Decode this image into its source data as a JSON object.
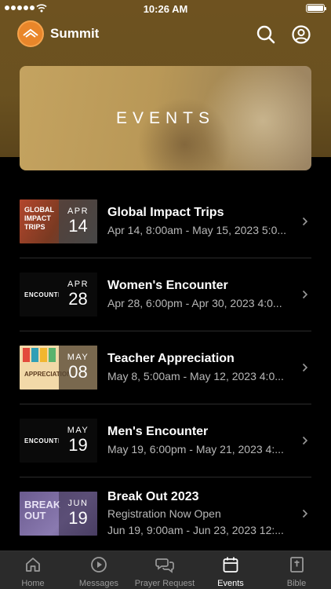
{
  "status_bar": {
    "time": "10:26 AM"
  },
  "header": {
    "app_title": "Summit",
    "accent_color": "#e9862a"
  },
  "banner": {
    "title": "EVENTS"
  },
  "events": [
    {
      "title": "Global Impact Trips",
      "lines": [
        "Apr 14, 8:00am - May 15, 2023 5:0..."
      ],
      "month": "APR",
      "day": "14",
      "thumb_text": "GLOBAL IMPACT TRIPS"
    },
    {
      "title": "Women's Encounter",
      "lines": [
        "Apr 28, 6:00pm - Apr 30, 2023 4:0..."
      ],
      "month": "APR",
      "day": "28",
      "thumb_text": "ENCOUNTER"
    },
    {
      "title": "Teacher Appreciation",
      "lines": [
        "May 8, 5:00am - May 12, 2023 4:0..."
      ],
      "month": "MAY",
      "day": "08",
      "thumb_text": "APPRECIATION"
    },
    {
      "title": "Men's Encounter",
      "lines": [
        "May 19, 6:00pm - May 21, 2023 4:..."
      ],
      "month": "MAY",
      "day": "19",
      "thumb_text": "ENCOUNTER"
    },
    {
      "title": "Break Out 2023",
      "lines": [
        "Registration Now Open",
        "Jun 19, 9:00am - Jun 23, 2023 12:..."
      ],
      "month": "JUN",
      "day": "19",
      "thumb_text": "BREAK OUT"
    }
  ],
  "tabs": [
    {
      "label": "Home",
      "icon": "home-icon",
      "active": false
    },
    {
      "label": "Messages",
      "icon": "play-icon",
      "active": false
    },
    {
      "label": "Prayer Request",
      "icon": "chat-icon",
      "active": false
    },
    {
      "label": "Events",
      "icon": "calendar-icon",
      "active": true
    },
    {
      "label": "Bible",
      "icon": "bible-icon",
      "active": false
    }
  ]
}
